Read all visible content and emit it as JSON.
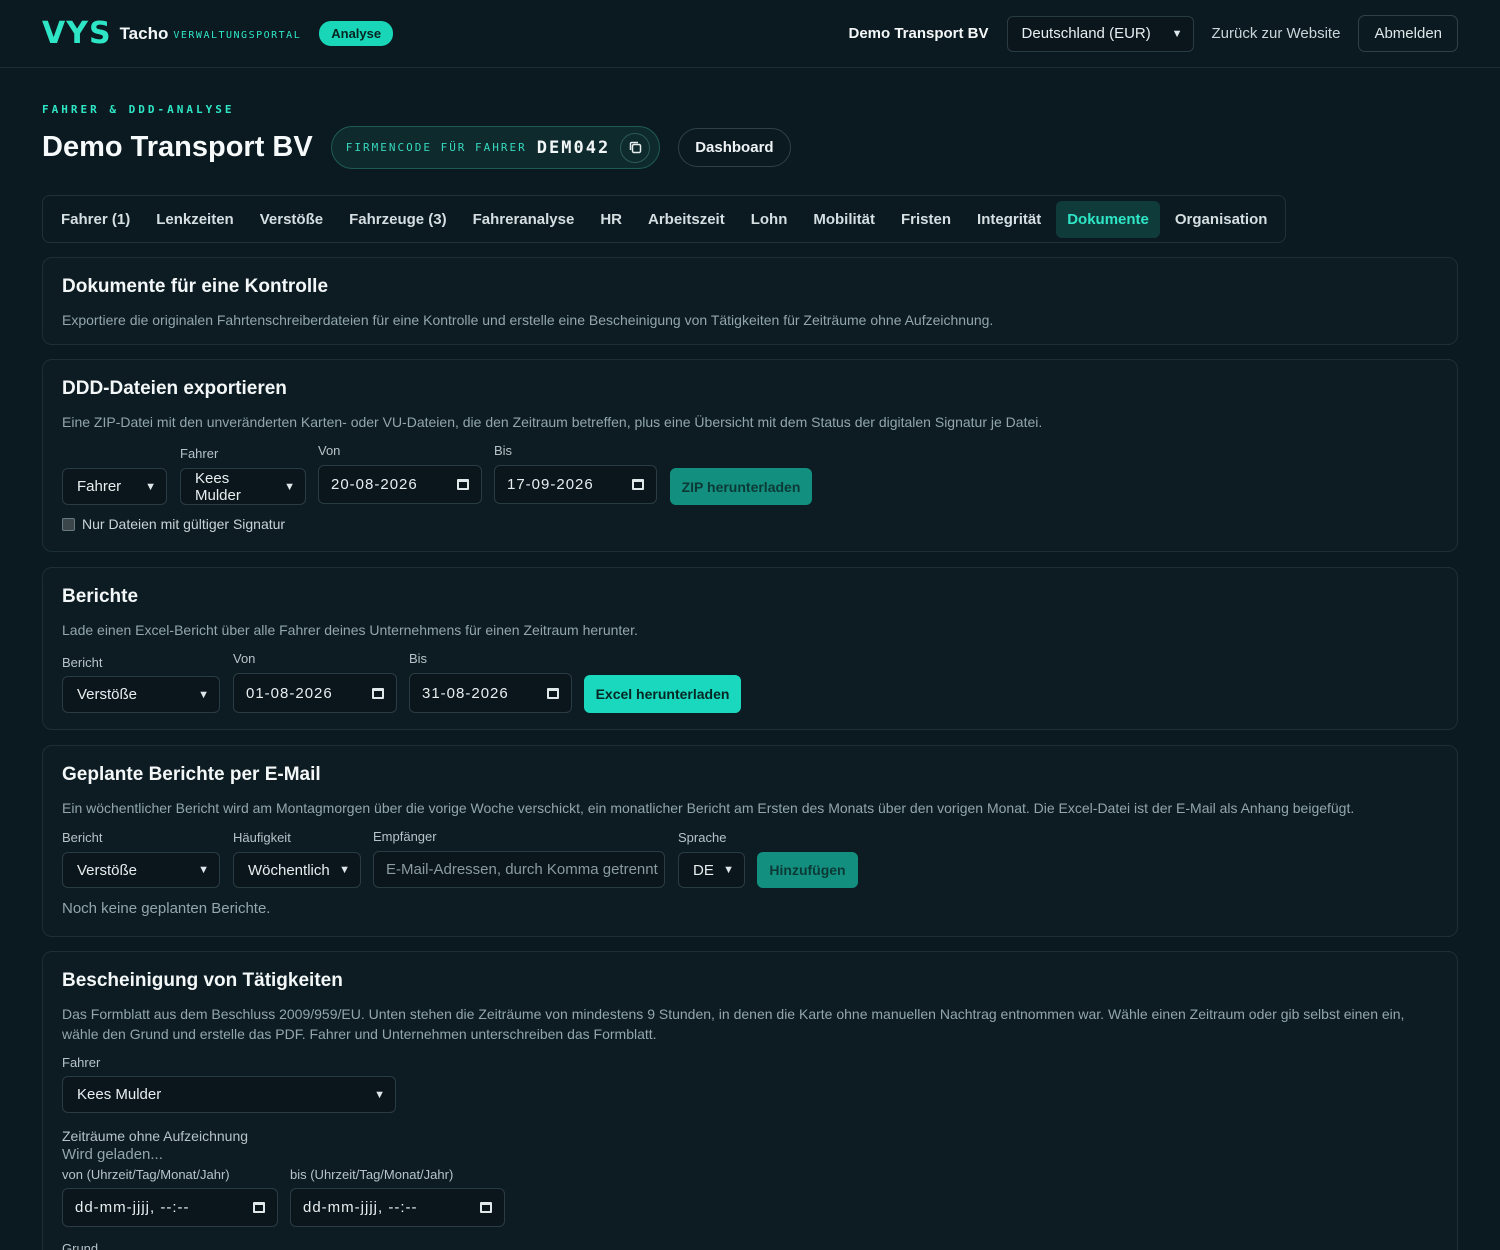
{
  "header": {
    "logo_mark": "VYS",
    "logo_tacho": "Tacho",
    "logo_sub": "VERWALTUNGSPORTAL",
    "badge": "Analyse",
    "company": "Demo Transport BV",
    "region_select": "Deutschland (EUR)",
    "back_link": "Zurück zur Website",
    "logout": "Abmelden"
  },
  "page": {
    "eyebrow": "FAHRER & DDD-ANALYSE",
    "title": "Demo Transport BV",
    "code_label": "FIRMENCODE FÜR FAHRER",
    "code_value": "DEM042",
    "dashboard_button": "Dashboard"
  },
  "tabs": [
    {
      "label": "Fahrer (1)"
    },
    {
      "label": "Lenkzeiten"
    },
    {
      "label": "Verstöße"
    },
    {
      "label": "Fahrzeuge (3)"
    },
    {
      "label": "Fahreranalyse"
    },
    {
      "label": "HR"
    },
    {
      "label": "Arbeitszeit"
    },
    {
      "label": "Lohn"
    },
    {
      "label": "Mobilität"
    },
    {
      "label": "Fristen"
    },
    {
      "label": "Integrität"
    },
    {
      "label": "Dokumente"
    },
    {
      "label": "Organisation"
    }
  ],
  "intro": {
    "title": "Dokumente für eine Kontrolle",
    "desc": "Exportiere die originalen Fahrtenschreiberdateien für eine Kontrolle und erstelle eine Bescheinigung von Tätigkeiten für Zeiträume ohne Aufzeichnung."
  },
  "ddd": {
    "title": "DDD-Dateien exportieren",
    "desc": "Eine ZIP-Datei mit den unveränderten Karten- oder VU-Dateien, die den Zeitraum betreffen, plus eine Übersicht mit dem Status der digitalen Signatur je Datei.",
    "type_select": "Fahrer",
    "driver_label": "Fahrer",
    "driver_select": "Kees Mulder",
    "from_label": "Von",
    "from_value": "20-08-2026",
    "to_label": "Bis",
    "to_value": "17-09-2026",
    "button": "ZIP herunterladen",
    "checkbox_label": "Nur Dateien mit gültiger Signatur"
  },
  "reports": {
    "title": "Berichte",
    "desc": "Lade einen Excel-Bericht über alle Fahrer deines Unternehmens für einen Zeitraum herunter.",
    "report_label": "Bericht",
    "report_select": "Verstöße",
    "from_label": "Von",
    "from_value": "01-08-2026",
    "to_label": "Bis",
    "to_value": "31-08-2026",
    "button": "Excel herunterladen"
  },
  "scheduled": {
    "title": "Geplante Berichte per E-Mail",
    "desc": "Ein wöchentlicher Bericht wird am Montagmorgen über die vorige Woche verschickt, ein monatlicher Bericht am Ersten des Monats über den vorigen Monat. Die Excel-Datei ist der E-Mail als Anhang beigefügt.",
    "report_label": "Bericht",
    "report_select": "Verstöße",
    "freq_label": "Häufigkeit",
    "freq_select": "Wöchentlich",
    "recipients_label": "Empfänger",
    "recipients_placeholder": "E-Mail-Adressen, durch Komma getrennt",
    "lang_label": "Sprache",
    "lang_select": "DE",
    "button": "Hinzufügen",
    "empty": "Noch keine geplanten Berichte."
  },
  "certificate": {
    "title": "Bescheinigung von Tätigkeiten",
    "desc": "Das Formblatt aus dem Beschluss 2009/959/EU. Unten stehen die Zeiträume von mindestens 9 Stunden, in denen die Karte ohne manuellen Nachtrag entnommen war. Wähle einen Zeitraum oder gib selbst einen ein, wähle den Grund und erstelle das PDF. Fahrer und Unternehmen unterschreiben das Formblatt.",
    "driver_label": "Fahrer",
    "driver_select": "Kees Mulder",
    "periods_label": "Zeiträume ohne Aufzeichnung",
    "loading": "Wird geladen...",
    "from_label": "von (Uhrzeit/Tag/Monat/Jahr)",
    "from_placeholder": "dd-mm-jjjj, --:--",
    "to_label": "bis (Uhrzeit/Tag/Monat/Jahr)",
    "to_placeholder": "dd-mm-jjjj, --:--",
    "reason_label": "Grund"
  },
  "colors": {
    "accent": "#2ee6c6",
    "background": "#0b1a20",
    "card": "#0c1c22"
  }
}
